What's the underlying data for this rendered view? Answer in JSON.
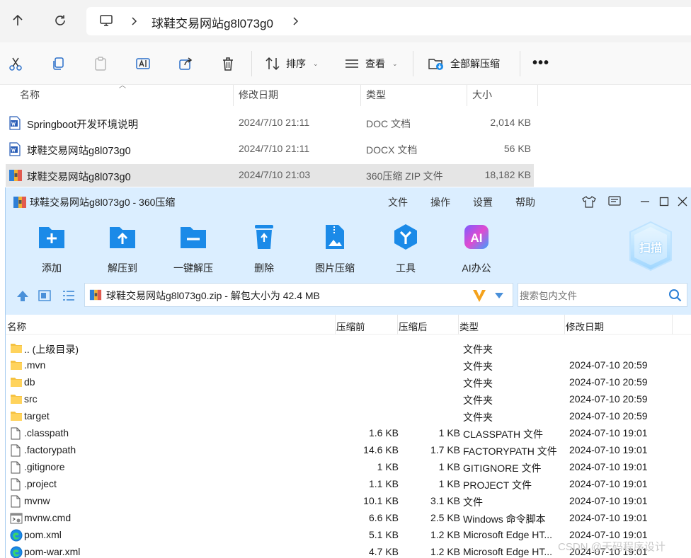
{
  "explorer": {
    "address": {
      "path_label": "球鞋交易网站g8l073g0"
    },
    "commands": {
      "sort_label": "排序",
      "view_label": "查看",
      "extract_all_label": "全部解压缩",
      "more_label": "•••"
    },
    "columns": {
      "name": "名称",
      "modified": "修改日期",
      "type": "类型",
      "size": "大小"
    },
    "files": [
      {
        "name": "Springboot开发环境说明",
        "date": "2024/7/10 21:11",
        "type": "DOC 文档",
        "size": "2,014 KB",
        "icon": "word-doc-icon"
      },
      {
        "name": "球鞋交易网站g8l073g0",
        "date": "2024/7/10 21:11",
        "type": "DOCX 文档",
        "size": "56 KB",
        "icon": "word-doc-icon"
      },
      {
        "name": "球鞋交易网站g8l073g0",
        "date": "2024/7/10 21:03",
        "type": "360压缩 ZIP 文件",
        "size": "18,182 KB",
        "icon": "zip-archive-icon",
        "selected": true
      }
    ]
  },
  "zip": {
    "title": "球鞋交易网站g8l073g0 - 360压缩",
    "menu": [
      "文件",
      "操作",
      "设置",
      "帮助"
    ],
    "toolbar": [
      {
        "label": "添加",
        "icon": "add-folder-icon"
      },
      {
        "label": "解压到",
        "icon": "extract-to-icon"
      },
      {
        "label": "一键解压",
        "icon": "one-click-extract-icon"
      },
      {
        "label": "删除",
        "icon": "recycle-bin-icon"
      },
      {
        "label": "图片压缩",
        "icon": "image-compress-icon"
      },
      {
        "label": "工具",
        "icon": "tools-icon"
      },
      {
        "label": "AI办公",
        "icon": "ai-office-icon"
      }
    ],
    "scan_label": "扫描",
    "path_text": "球鞋交易网站g8l073g0.zip - 解包大小为 42.4 MB",
    "search_placeholder": "搜索包内文件",
    "columns": {
      "name": "名称",
      "size": "压缩前",
      "compressed": "压缩后",
      "type": "类型",
      "modified": "修改日期"
    },
    "rows": [
      {
        "name": ".. (上级目录)",
        "size": "",
        "compressed": "",
        "type": "文件夹",
        "date": "",
        "icon": "folder-icon"
      },
      {
        "name": ".mvn",
        "size": "",
        "compressed": "",
        "type": "文件夹",
        "date": "2024-07-10 20:59",
        "icon": "folder-icon"
      },
      {
        "name": "db",
        "size": "",
        "compressed": "",
        "type": "文件夹",
        "date": "2024-07-10 20:59",
        "icon": "folder-icon"
      },
      {
        "name": "src",
        "size": "",
        "compressed": "",
        "type": "文件夹",
        "date": "2024-07-10 20:59",
        "icon": "folder-icon"
      },
      {
        "name": "target",
        "size": "",
        "compressed": "",
        "type": "文件夹",
        "date": "2024-07-10 20:59",
        "icon": "folder-icon"
      },
      {
        "name": ".classpath",
        "size": "1.6 KB",
        "compressed": "1 KB",
        "type": "CLASSPATH 文件",
        "date": "2024-07-10 19:01",
        "icon": "file-icon"
      },
      {
        "name": ".factorypath",
        "size": "14.6 KB",
        "compressed": "1.7 KB",
        "type": "FACTORYPATH 文件",
        "date": "2024-07-10 19:01",
        "icon": "file-icon"
      },
      {
        "name": ".gitignore",
        "size": "1 KB",
        "compressed": "1 KB",
        "type": "GITIGNORE 文件",
        "date": "2024-07-10 19:01",
        "icon": "file-icon"
      },
      {
        "name": ".project",
        "size": "1.1 KB",
        "compressed": "1 KB",
        "type": "PROJECT 文件",
        "date": "2024-07-10 19:01",
        "icon": "file-icon"
      },
      {
        "name": "mvnw",
        "size": "10.1 KB",
        "compressed": "3.1 KB",
        "type": "文件",
        "date": "2024-07-10 19:01",
        "icon": "file-icon"
      },
      {
        "name": "mvnw.cmd",
        "size": "6.6 KB",
        "compressed": "2.5 KB",
        "type": "Windows 命令脚本",
        "date": "2024-07-10 19:01",
        "icon": "cmd-script-icon"
      },
      {
        "name": "pom.xml",
        "size": "5.1 KB",
        "compressed": "1.2 KB",
        "type": "Microsoft Edge HT...",
        "date": "2024-07-10 19:01",
        "icon": "edge-icon"
      },
      {
        "name": "pom-war.xml",
        "size": "4.7 KB",
        "compressed": "1.2 KB",
        "type": "Microsoft Edge HT...",
        "date": "2024-07-10 19:01",
        "icon": "edge-icon"
      }
    ]
  },
  "watermark": "CSDN @天码程序设计",
  "colors": {
    "zip_bg": "#dbeeff",
    "accent_blue": "#1b8ae8",
    "selected_row": "#e5e5e5"
  }
}
